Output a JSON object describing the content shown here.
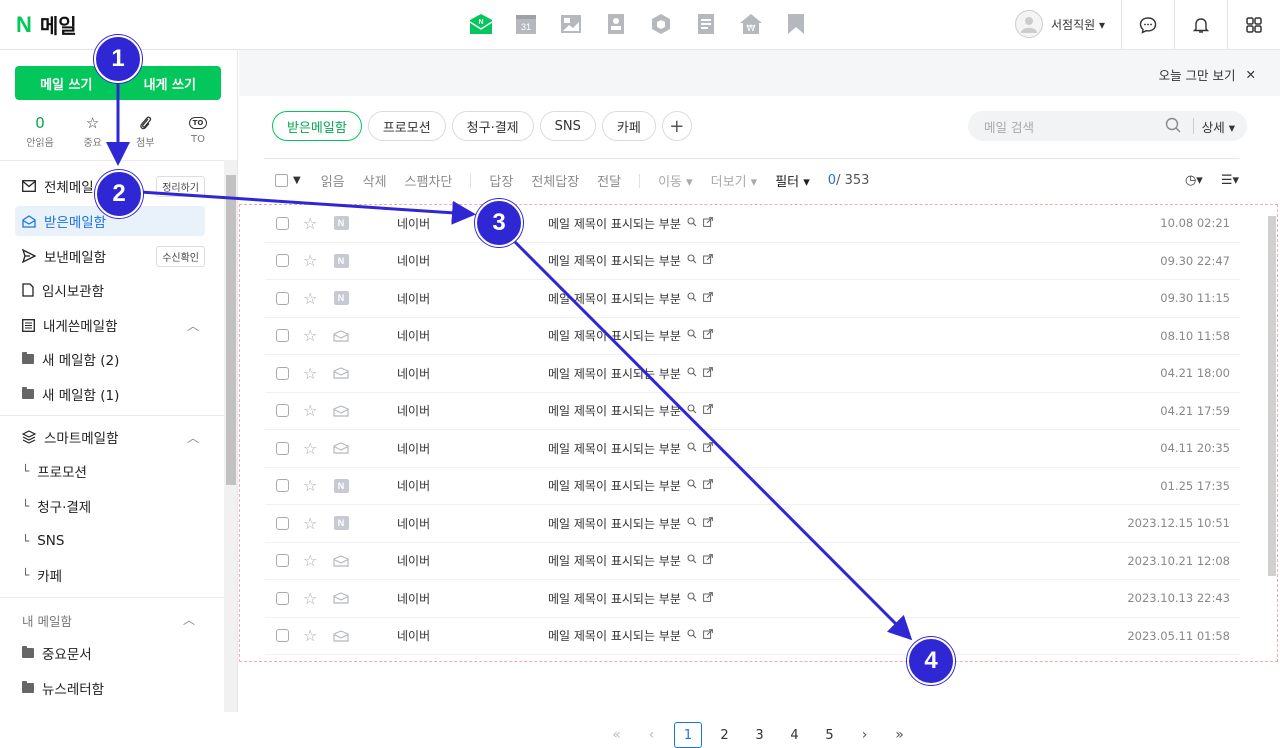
{
  "header": {
    "logo_n": "N",
    "logo_text": "메일",
    "apps": [
      {
        "icon": "mail-icon",
        "label": "N"
      },
      {
        "icon": "calendar-icon",
        "label": "31"
      },
      {
        "icon": "photo-icon",
        "label": ""
      },
      {
        "icon": "contacts-icon",
        "label": ""
      },
      {
        "icon": "box-icon",
        "label": ""
      },
      {
        "icon": "memo-icon",
        "label": ""
      },
      {
        "icon": "pay-icon",
        "label": "₩"
      },
      {
        "icon": "bookmark-icon",
        "label": ""
      }
    ],
    "user_name": "서점직원 ▾",
    "icons": [
      "chat-icon",
      "bell-icon",
      "apps-grid-icon"
    ]
  },
  "sidebar": {
    "write_mail": "메일 쓰기",
    "write_self": "내게 쓰기",
    "quick": [
      {
        "value": "0",
        "label": "안읽음"
      },
      {
        "icon": "☆",
        "label": "중요"
      },
      {
        "icon": "⌇",
        "label": "첨부"
      },
      {
        "icon": "TO",
        "label": "TO"
      }
    ],
    "items": [
      {
        "label": "전체메일",
        "badge": "정리하기"
      },
      {
        "label": "받은메일함"
      },
      {
        "label": "보낸메일함",
        "badge": "수신확인"
      },
      {
        "label": "임시보관함"
      },
      {
        "label": "내게쓴메일함"
      },
      {
        "label": "새 메일함 (2)"
      },
      {
        "label": "새 메일함 (1)"
      },
      {
        "label": "스마트메일함"
      },
      {
        "label": "프로모션"
      },
      {
        "label": "청구·결제"
      },
      {
        "label": "SNS"
      },
      {
        "label": "카페"
      }
    ],
    "my_mailbox_label": "내 메일함",
    "my_items": [
      {
        "label": "중요문서"
      },
      {
        "label": "뉴스레터함"
      }
    ]
  },
  "main": {
    "notice": "오늘 그만 보기",
    "close_glyph": "✕",
    "tabs": [
      "받은메일함",
      "프로모션",
      "청구·결제",
      "SNS",
      "카페",
      "+"
    ],
    "search_placeholder": "메일 검색",
    "search_detail": "상세 ▾",
    "toolbar": {
      "read": "읽음",
      "delete": "삭제",
      "spam": "스팸차단",
      "reply": "답장",
      "reply_all": "전체답장",
      "forward": "전달",
      "move": "이동 ▾",
      "more": "더보기 ▾",
      "filter": "필터 ▾",
      "count_unread": "0",
      "count_total": "/ 353",
      "sort_glyph": "◷▾",
      "view_glyph": "☰▾"
    },
    "rows": [
      {
        "icon": "N",
        "sender": "네이버",
        "subject": "메일 제목이 표시되는 부분",
        "date": "10.08 02:21"
      },
      {
        "icon": "N",
        "sender": "네이버",
        "subject": "메일 제목이 표시되는 부분",
        "date": "09.30 22:47"
      },
      {
        "icon": "N",
        "sender": "네이버",
        "subject": "메일 제목이 표시되는 부분",
        "date": "09.30 11:15"
      },
      {
        "icon": "mail",
        "sender": "네이버",
        "subject": "메일 제목이 표시되는 부분",
        "date": "08.10 11:58"
      },
      {
        "icon": "mail",
        "sender": "네이버",
        "subject": "메일 제목이 표시되는 부분",
        "date": "04.21 18:00"
      },
      {
        "icon": "mail",
        "sender": "네이버",
        "subject": "메일 제목이 표시되는 부분",
        "date": "04.21 17:59"
      },
      {
        "icon": "mail",
        "sender": "네이버",
        "subject": "메일 제목이 표시되는 부분",
        "date": "04.11 20:35"
      },
      {
        "icon": "N",
        "sender": "네이버",
        "subject": "메일 제목이 표시되는 부분",
        "date": "01.25 17:35"
      },
      {
        "icon": "N",
        "sender": "네이버",
        "subject": "메일 제목이 표시되는 부분",
        "date": "2023.12.15 10:51"
      },
      {
        "icon": "mail",
        "sender": "네이버",
        "subject": "메일 제목이 표시되는 부분",
        "date": "2023.10.21 12:08"
      },
      {
        "icon": "mail",
        "sender": "네이버",
        "subject": "메일 제목이 표시되는 부분",
        "date": "2023.10.13 22:43"
      },
      {
        "icon": "mail",
        "sender": "네이버",
        "subject": "메일 제목이 표시되는 부분",
        "date": "2023.05.11 01:58"
      }
    ],
    "pagination": {
      "first": "«",
      "prev": "‹",
      "pages": [
        "1",
        "2",
        "3",
        "4",
        "5"
      ],
      "next": "›",
      "last": "»"
    }
  },
  "annotations": {
    "markers": [
      "1",
      "2",
      "3",
      "4"
    ],
    "color": "#2f27d4"
  }
}
